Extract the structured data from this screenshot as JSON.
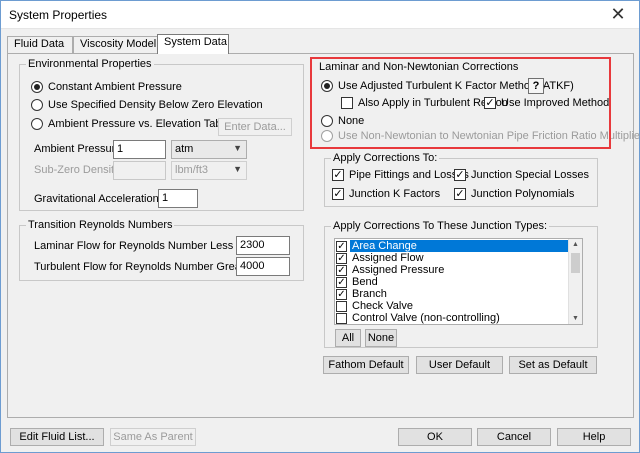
{
  "window": {
    "title": "System Properties",
    "close_glyph": "✕"
  },
  "tabs": [
    {
      "label": "Fluid Data"
    },
    {
      "label": "Viscosity Model"
    },
    {
      "label": "System Data"
    }
  ],
  "environmental": {
    "legend": "Environmental Properties",
    "options": [
      {
        "label": "Constant Ambient Pressure",
        "selected": true
      },
      {
        "label": "Use Specified Density Below Zero Elevation",
        "selected": false
      },
      {
        "label": "Ambient Pressure vs. Elevation Table",
        "selected": false
      }
    ],
    "enter_data_label": "Enter Data...",
    "ambient_pressure_label": "Ambient Pressure:",
    "ambient_pressure_value": "1",
    "ambient_pressure_unit": "atm",
    "subzero_density_label": "Sub-Zero Density:",
    "subzero_density_value": "",
    "subzero_density_unit": "lbm/ft3",
    "gravitational_label": "Gravitational Acceleration (g's):",
    "gravitational_value": "1"
  },
  "reynolds": {
    "legend": "Transition Reynolds Numbers",
    "laminar_label": "Laminar Flow for Reynolds Number Less Than:",
    "laminar_value": "2300",
    "turbulent_label": "Turbulent Flow for Reynolds Number Greater Than:",
    "turbulent_value": "4000"
  },
  "corrections": {
    "legend": "Laminar and Non-Newtonian Corrections",
    "atkf_label": "Use Adjusted Turbulent K Factor Method (ATKF)",
    "help_label": "?",
    "also_turbulent_label": "Also Apply in Turbulent Region",
    "also_turbulent_checked": false,
    "improved_label": "Use Improved Method",
    "improved_checked": true,
    "none_label": "None",
    "non_newtonian_label": "Use Non-Newtonian to Newtonian Pipe Friction Ratio Multiplier"
  },
  "apply_to": {
    "legend": "Apply Corrections To:",
    "items": [
      {
        "label": "Pipe Fittings and Losses",
        "checked": true
      },
      {
        "label": "Junction Special Losses",
        "checked": true
      },
      {
        "label": "Junction K Factors",
        "checked": true
      },
      {
        "label": "Junction Polynomials",
        "checked": true
      }
    ]
  },
  "junction_types": {
    "legend": "Apply Corrections To These Junction Types:",
    "items": [
      {
        "label": "Area Change",
        "checked": true,
        "selected": true
      },
      {
        "label": "Assigned Flow",
        "checked": true
      },
      {
        "label": "Assigned Pressure",
        "checked": true
      },
      {
        "label": "Bend",
        "checked": true
      },
      {
        "label": "Branch",
        "checked": true
      },
      {
        "label": "Check Valve",
        "checked": false
      },
      {
        "label": "Control Valve (non-controlling)",
        "checked": false
      }
    ],
    "all_label": "All",
    "none_label": "None"
  },
  "defaults": {
    "fathom_label": "Fathom Default",
    "user_label": "User Default",
    "set_label": "Set as Default"
  },
  "footer": {
    "edit_fluid_label": "Edit Fluid List...",
    "same_parent_label": "Same As Parent",
    "ok_label": "OK",
    "cancel_label": "Cancel",
    "help_label": "Help"
  },
  "glyphs": {
    "check": "✓",
    "dropdown": "▼",
    "scroll_up": "▲",
    "scroll_down": "▼"
  },
  "colors": {
    "highlight_box": "#e8393c",
    "selection": "#0078d7"
  }
}
